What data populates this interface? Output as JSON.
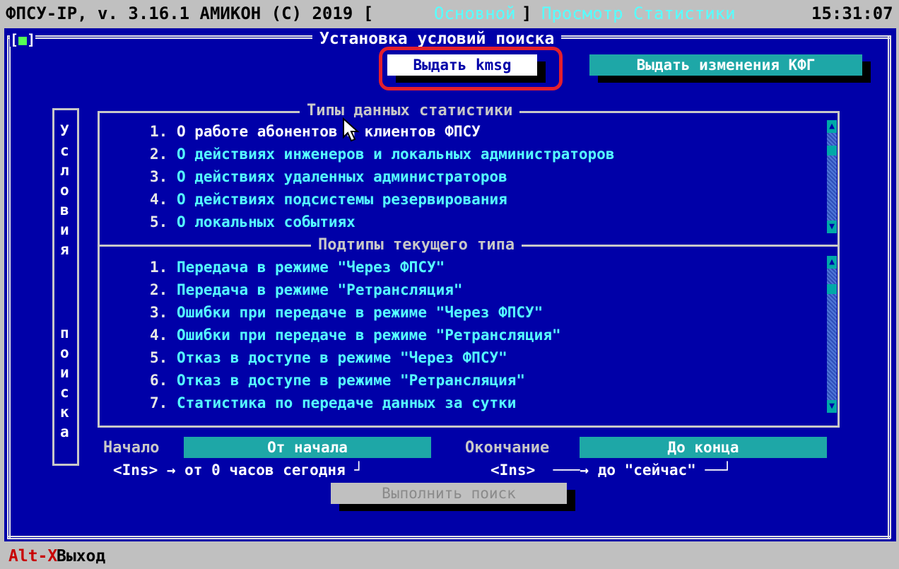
{
  "topbar": {
    "app": "ФПСУ-IP, v. 3.16.1  АМИКОН (С) 2019 [",
    "mode": "Основной",
    "bracket_close": "]",
    "view": "Просмотр Статистики",
    "clock": "15:31:07"
  },
  "window": {
    "title": "Установка условий поиска",
    "close_mark_left": "[",
    "close_mark_inner": "■",
    "close_mark_right": "]"
  },
  "buttons": {
    "kmsg": "Выдать kmsg",
    "kfg": "Выдать изменения КФГ",
    "search": "Выполнить поиск"
  },
  "vertical_label": [
    "У",
    "с",
    "л",
    "о",
    "в",
    "и",
    "я",
    "",
    "",
    "п",
    "о",
    "и",
    "с",
    "к",
    "а"
  ],
  "types_group": {
    "caption": "Типы данных статистики",
    "items": [
      {
        "num": "1.",
        "text": "О работе абонентов и клиентов ФПСУ",
        "selected": true
      },
      {
        "num": "2.",
        "text": "О действиях инженеров и локальных администраторов",
        "selected": false
      },
      {
        "num": "3.",
        "text": "О действиях удаленных администраторов",
        "selected": false
      },
      {
        "num": "4.",
        "text": "О действиях подсистемы резервирования",
        "selected": false
      },
      {
        "num": "5.",
        "text": "О локальных событиях",
        "selected": false
      }
    ]
  },
  "subtypes_group": {
    "caption": "Подтипы текущего типа",
    "items": [
      {
        "num": "1.",
        "text": "Передача в режиме \"Через ФПСУ\""
      },
      {
        "num": "2.",
        "text": "Передача в режиме \"Ретрансляция\""
      },
      {
        "num": "3.",
        "text": "Ошибки при передаче в режиме \"Через ФПСУ\""
      },
      {
        "num": "4.",
        "text": "Ошибки при передаче в режиме \"Ретрансляция\""
      },
      {
        "num": "5.",
        "text": "Отказ в доступе в режиме \"Через ФПСУ\""
      },
      {
        "num": "6.",
        "text": "Отказ в доступе в режиме \"Ретрансляция\""
      },
      {
        "num": "7.",
        "text": "Статистика по передаче данных за сутки"
      }
    ]
  },
  "range": {
    "start_label": "Начало",
    "start_value": "От начала",
    "end_label": "Окончание",
    "end_value": "До конца",
    "start_hint": "<Ins> → от 0 часов сегодня ┘",
    "end_hint": "<Ins>  ───→ до \"сейчас\" ──┘"
  },
  "statusbar": {
    "key": "Alt-X",
    "label": "Выход"
  },
  "colors": {
    "window_bg": "#0000a8",
    "highlight": "#e31f2d",
    "accent_cyan": "#55ffff"
  }
}
